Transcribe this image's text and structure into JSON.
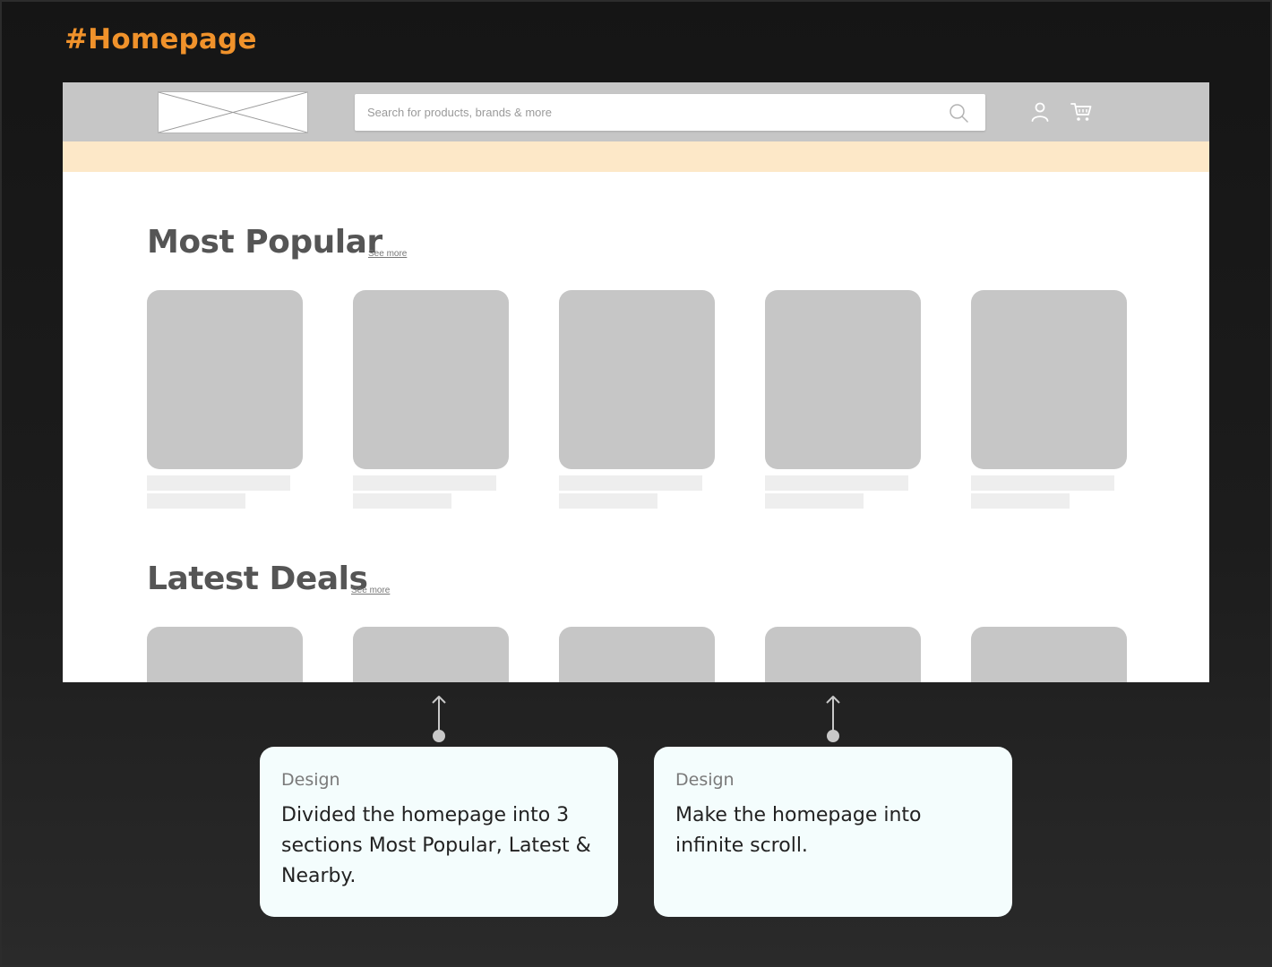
{
  "page": {
    "heading": "#Homepage",
    "accent_color": "#f0922b"
  },
  "wireframe": {
    "logo": {
      "icon": "image-placeholder-icon"
    },
    "search": {
      "placeholder": "Search for products, brands & more",
      "icon": "search-icon"
    },
    "header_icons": [
      "user-icon",
      "cart-icon"
    ],
    "banner_color": "#fde8c8",
    "sections": [
      {
        "title": "Most Popular",
        "see_more": "See more",
        "card_count": 5
      },
      {
        "title": "Latest Deals",
        "see_more": "See more",
        "card_count": 5
      }
    ]
  },
  "annotations": [
    {
      "label": "Design",
      "text": "Divided the homepage into 3 sections Most Popular, Latest & Nearby."
    },
    {
      "label": "Design",
      "text": "Make the homepage into infinite scroll."
    }
  ]
}
